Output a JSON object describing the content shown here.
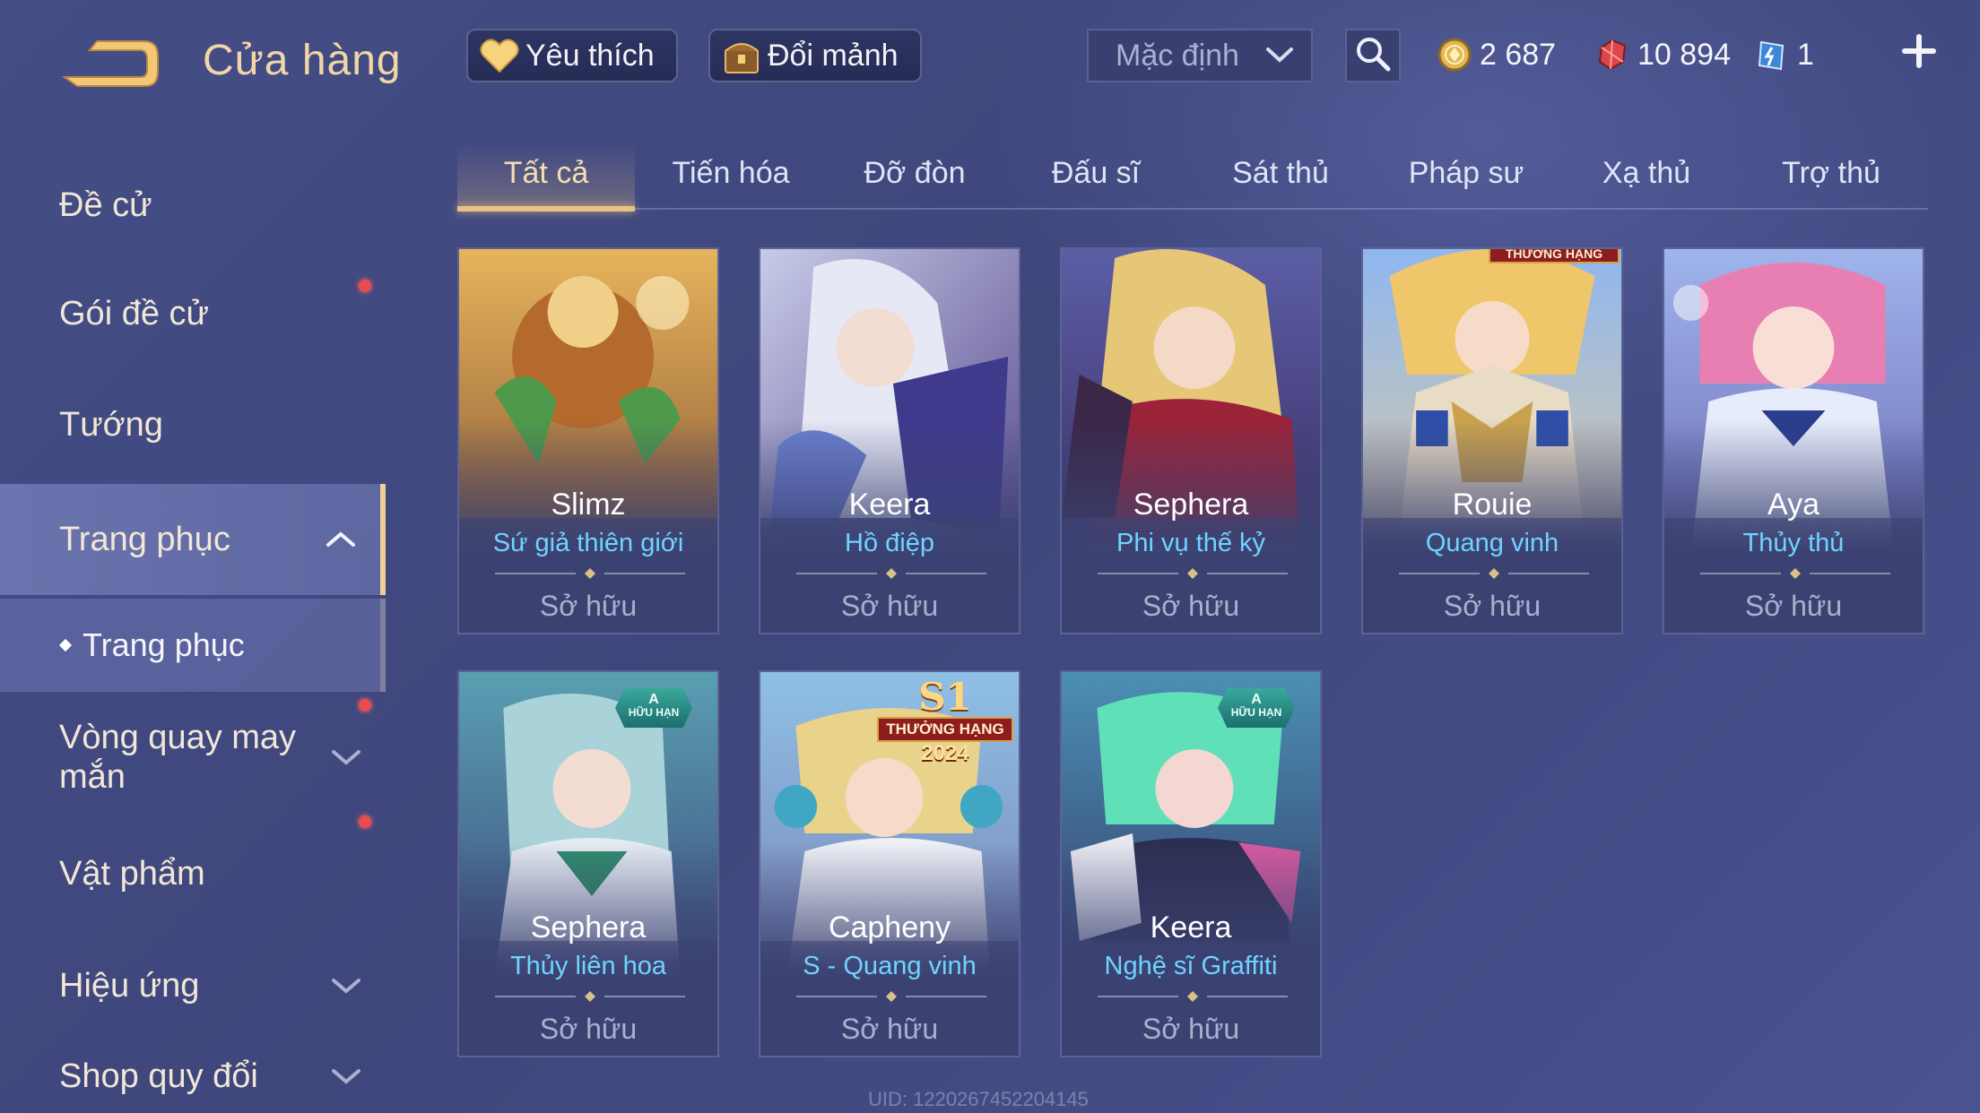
{
  "header": {
    "title": "Cửa hàng",
    "favorites_label": "Yêu thích",
    "trade_label": "Đổi mảnh",
    "sort_value": "Mặc định",
    "currencies": {
      "gold": "2 687",
      "ruby": "10 894",
      "voucher": "1"
    }
  },
  "sidebar": {
    "items": [
      {
        "label": "Đề cử"
      },
      {
        "label": "Gói đề cử"
      },
      {
        "label": "Tướng"
      },
      {
        "label": "Trang phục"
      },
      {
        "label": "Vòng quay may mắn"
      },
      {
        "label": "Vật phẩm"
      },
      {
        "label": "Hiệu ứng"
      },
      {
        "label": "Shop quy đổi"
      }
    ],
    "sub_item": "Trang phục"
  },
  "tabs": [
    "Tất cả",
    "Tiến hóa",
    "Đỡ đòn",
    "Đấu sĩ",
    "Sát thủ",
    "Pháp sư",
    "Xạ thủ",
    "Trợ thủ"
  ],
  "active_tab": "Tất cả",
  "cards": [
    {
      "hero": "Slimz",
      "skin": "Sứ giả thiên giới",
      "status": "Sở hữu"
    },
    {
      "hero": "Keera",
      "skin": "Hồ điệp",
      "status": "Sở hữu"
    },
    {
      "hero": "Sephera",
      "skin": "Phi vụ thế kỷ",
      "status": "Sở hữu"
    },
    {
      "hero": "Rouie",
      "skin": "Quang vinh",
      "status": "Sở hữu",
      "rank_badge": "THƯỞNG HẠNG"
    },
    {
      "hero": "Aya",
      "skin": "Thủy thủ",
      "status": "Sở hữu"
    },
    {
      "hero": "Sephera",
      "skin": "Thủy liên hoa",
      "status": "Sở hữu",
      "badge_grade": "A",
      "badge_text": "HỮU HẠN"
    },
    {
      "hero": "Capheny",
      "skin": "S - Quang vinh",
      "status": "Sở hữu",
      "season": "S1",
      "rank_badge": "THƯỞNG HẠNG",
      "year": "2024"
    },
    {
      "hero": "Keera",
      "skin": "Nghệ sĩ Graffiti",
      "status": "Sở hữu",
      "badge_grade": "A",
      "badge_text": "HỮU HẠN"
    }
  ],
  "uid": "UID: 1220267452204145",
  "colors": {
    "accent_gold": "#f0cf95",
    "skin_name_blue": "#6fd3ff",
    "notification_red": "#e84c4c"
  }
}
